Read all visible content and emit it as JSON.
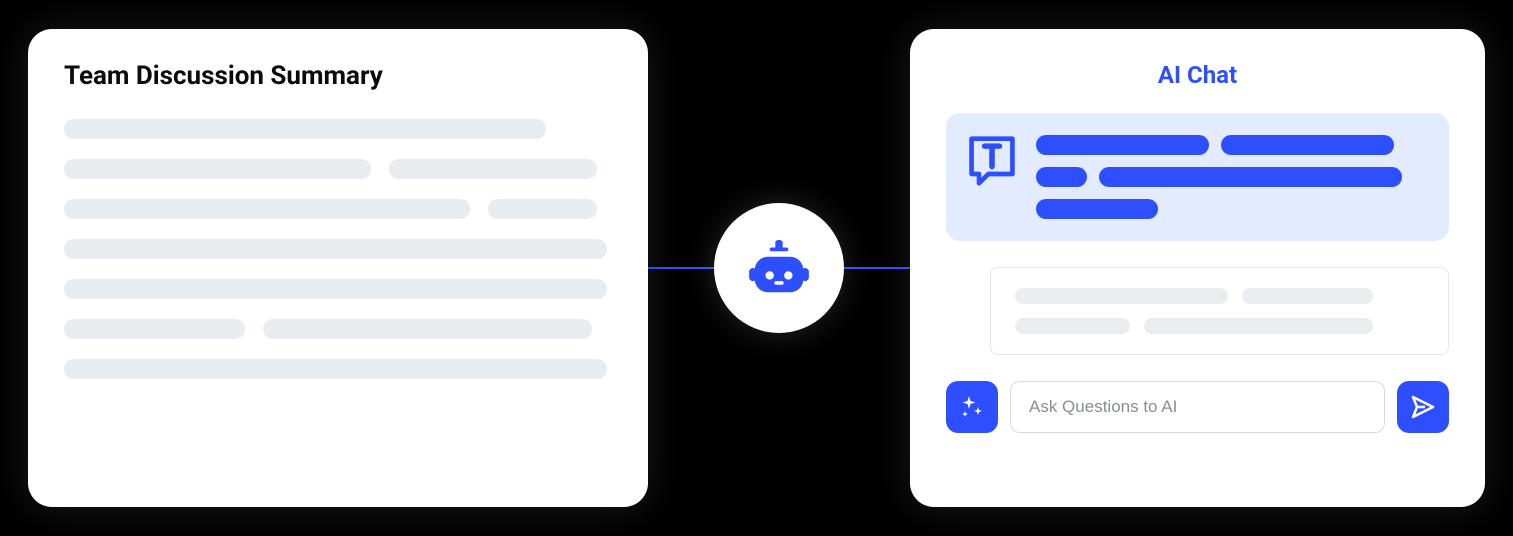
{
  "summary": {
    "title": "Team Discussion Summary"
  },
  "chat": {
    "title": "AI Chat",
    "input_placeholder": "Ask Questions to AI"
  },
  "icons": {
    "bot": "bot-icon",
    "sparkle": "sparkle-icon",
    "send": "send-icon",
    "thread": "thread-icon"
  },
  "colors": {
    "primary": "#2d4fff",
    "skeleton": "#e9ecef",
    "ai_bubble": "#e2ebff"
  }
}
